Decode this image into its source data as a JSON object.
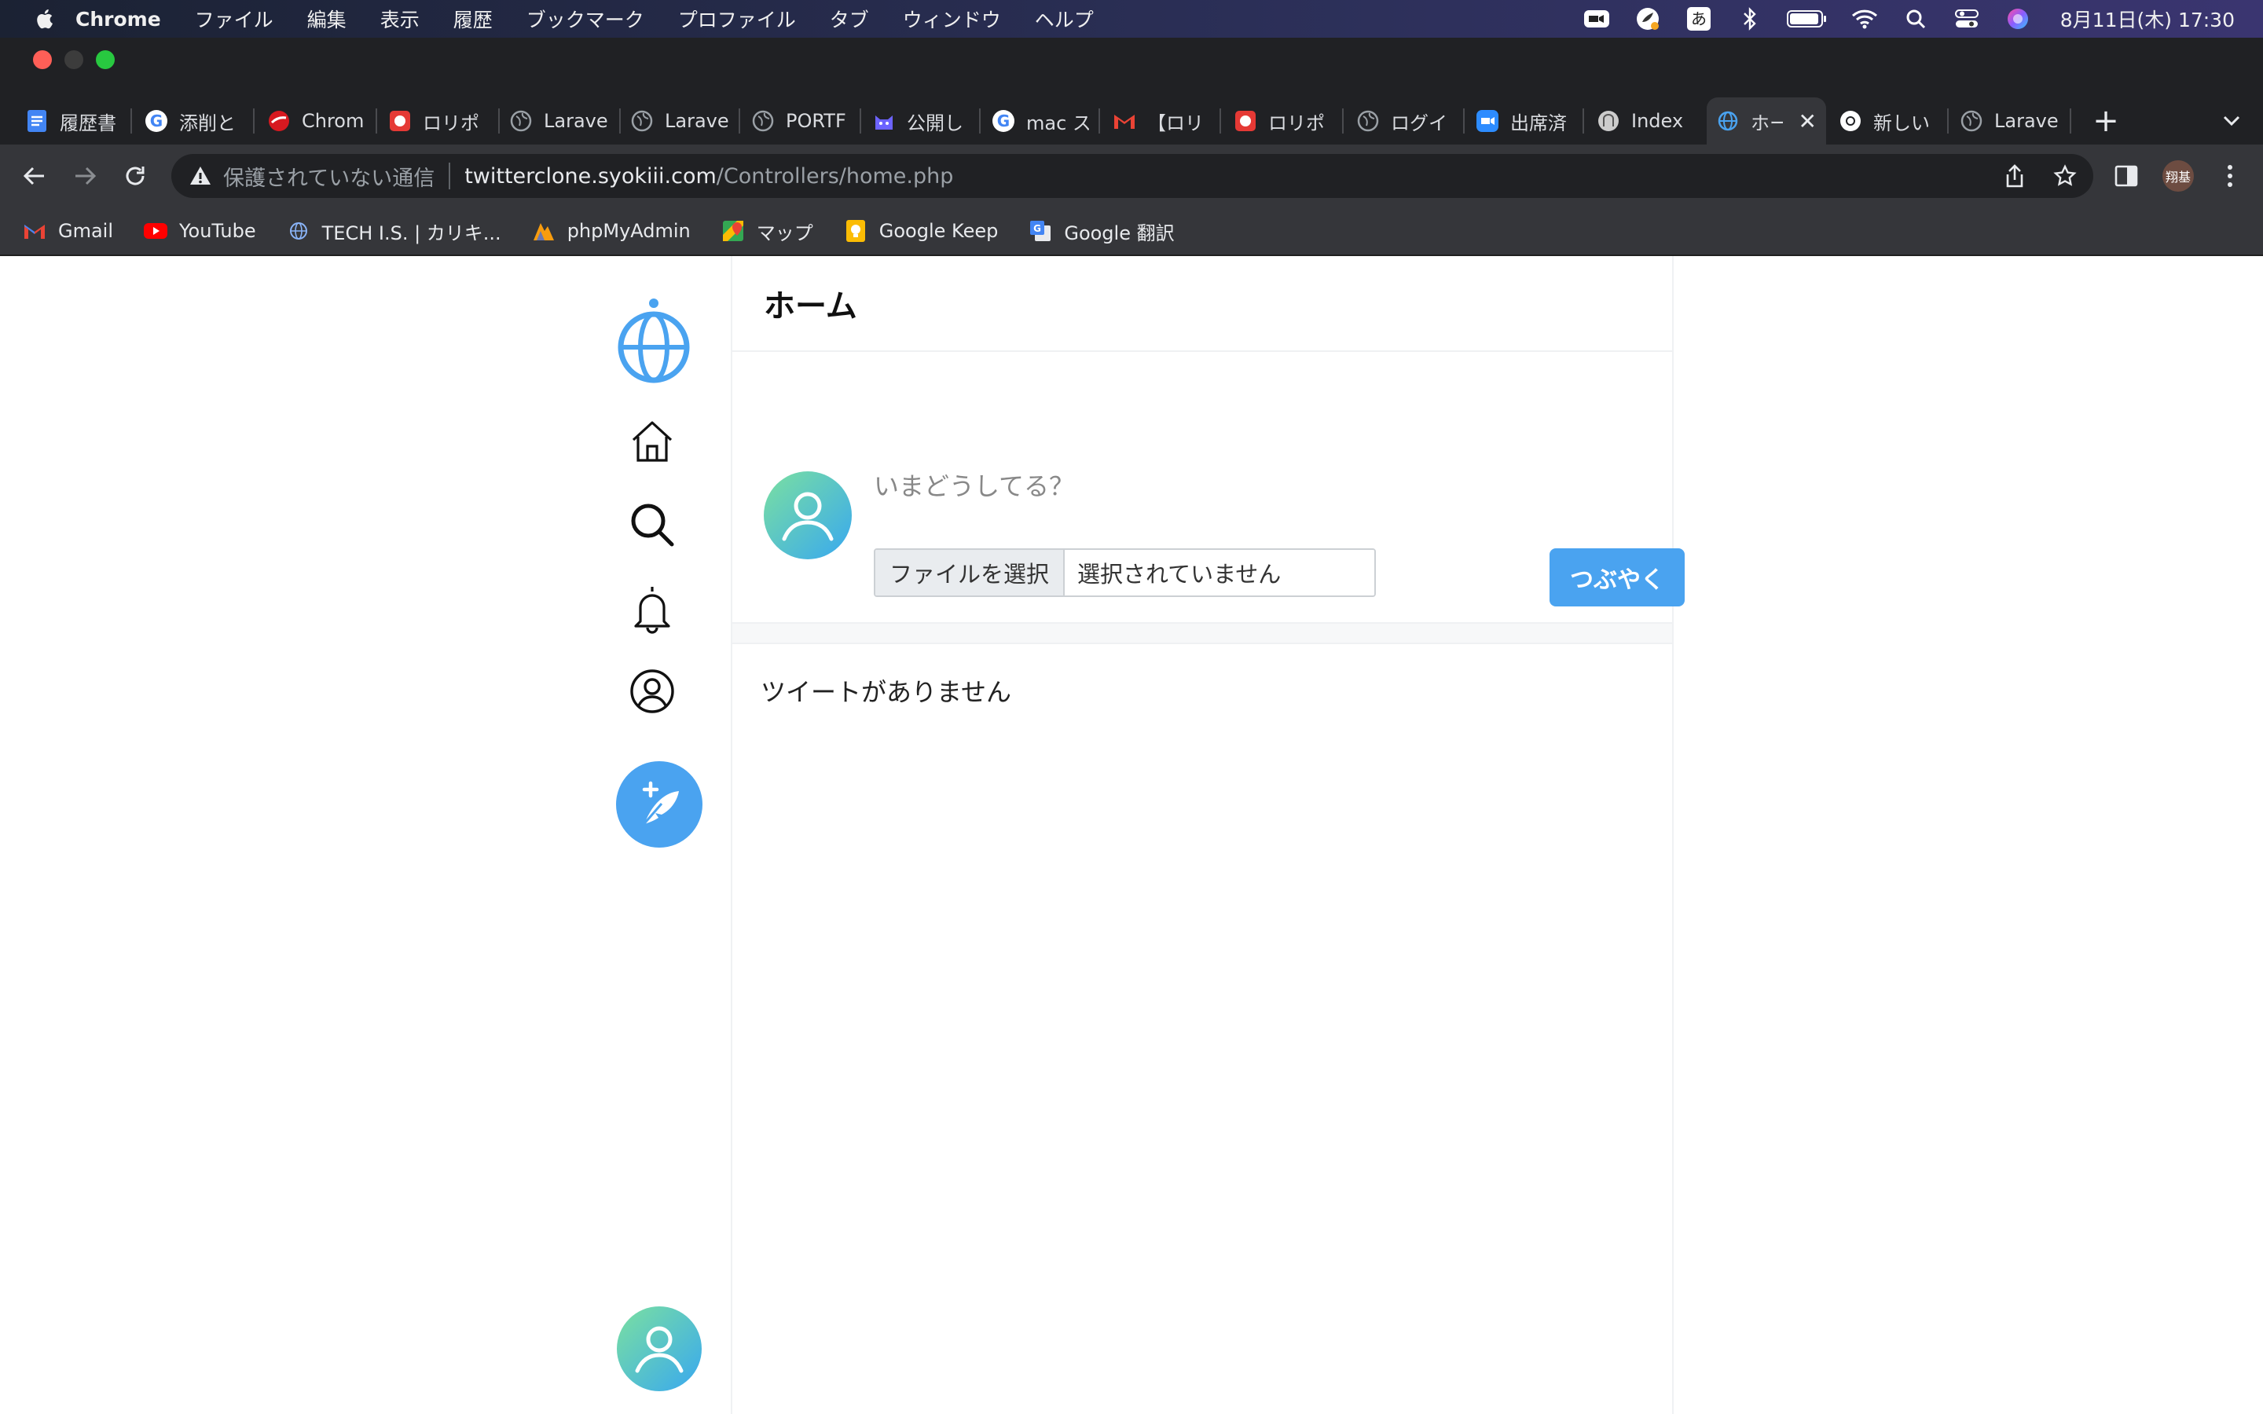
{
  "menubar": {
    "app_name": "Chrome",
    "items": [
      "ファイル",
      "編集",
      "表示",
      "履歴",
      "ブックマーク",
      "プロファイル",
      "タブ",
      "ウィンドウ",
      "ヘルプ"
    ],
    "ime": "あ",
    "clock": "8月11日(木)  17:30",
    "status_icons": [
      "zoom-icon",
      "app-icon",
      "input-method-icon",
      "bluetooth-icon",
      "battery-icon",
      "wifi-icon",
      "spotlight-icon",
      "control-center-icon",
      "siri-icon"
    ]
  },
  "tabs": [
    {
      "label": "履歴書",
      "icon": "google-docs-icon",
      "color": "#4285f4"
    },
    {
      "label": "添削と",
      "icon": "google-icon",
      "color": "#ffffff"
    },
    {
      "label": "Chrom",
      "icon": "trend-micro-icon",
      "color": "#d71920"
    },
    {
      "label": "ロリポ",
      "icon": "lolipop-icon",
      "color": "#e53935"
    },
    {
      "label": "Larave",
      "icon": "globe-icon",
      "color": "#9aa0a6"
    },
    {
      "label": "Larave",
      "icon": "globe-icon",
      "color": "#9aa0a6"
    },
    {
      "label": "PORTF",
      "icon": "globe-icon",
      "color": "#9aa0a6"
    },
    {
      "label": "公開し",
      "icon": "cat-icon",
      "color": "#6c63ff"
    },
    {
      "label": "mac ス",
      "icon": "google-icon",
      "color": "#ffffff"
    },
    {
      "label": "【ロリ",
      "icon": "gmail-icon",
      "color": "#ea4335"
    },
    {
      "label": "ロリポ",
      "icon": "lolipop-icon",
      "color": "#e53935"
    },
    {
      "label": "ログイ",
      "icon": "globe-icon",
      "color": "#9aa0a6"
    },
    {
      "label": "出席済",
      "icon": "zoom-icon",
      "color": "#2d8cff"
    },
    {
      "label": "Index",
      "icon": "elephant-icon",
      "color": "#cccccc"
    },
    {
      "label": "ホー",
      "icon": "site-globe-icon",
      "color": "#4aa3f0",
      "active": true
    },
    {
      "label": "新しい",
      "icon": "chrome-icon",
      "color": "#ffffff"
    },
    {
      "label": "Larave",
      "icon": "globe-icon",
      "color": "#9aa0a6"
    }
  ],
  "toolbar": {
    "security_label": "保護されていない通信",
    "url_host": "twitterclone.syokiii.com",
    "url_path": "/Controllers/home.php",
    "profile_initials": "翔基"
  },
  "bookmarks": [
    {
      "label": "Gmail",
      "icon": "gmail-icon"
    },
    {
      "label": "YouTube",
      "icon": "youtube-icon"
    },
    {
      "label": "TECH I.S. | カリキ...",
      "icon": "globe-icon"
    },
    {
      "label": "phpMyAdmin",
      "icon": "phpmyadmin-icon"
    },
    {
      "label": "マップ",
      "icon": "maps-icon"
    },
    {
      "label": "Google Keep",
      "icon": "keep-icon"
    },
    {
      "label": "Google 翻訳",
      "icon": "translate-icon"
    }
  ],
  "app": {
    "header_title": "ホーム",
    "composer_placeholder": "いまどうしてる？",
    "file_button_label": "ファイルを選択",
    "file_status": "選択されていません",
    "submit_label": "つぶやく",
    "empty_message": "ツイートがありません",
    "accent_color": "#4aa3f0"
  }
}
